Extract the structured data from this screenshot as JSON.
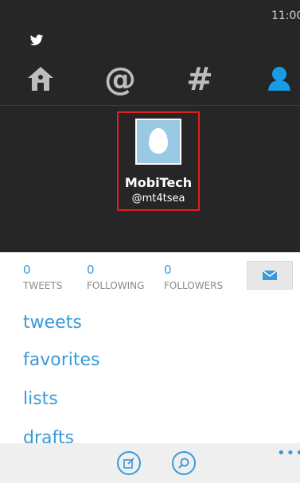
{
  "status_bar": {
    "time": "11:00"
  },
  "nav_tabs": [
    {
      "icon": "home-icon",
      "glyph": "⌂",
      "color": "#bdbdbd"
    },
    {
      "icon": "mentions-icon",
      "glyph": "@",
      "color": "#bdbdbd"
    },
    {
      "icon": "hashtag-icon",
      "glyph": "#",
      "color": "#bdbdbd"
    },
    {
      "icon": "profile-icon",
      "glyph": "",
      "color": "#1a9be6"
    }
  ],
  "profile": {
    "name": "MobiTech",
    "handle": "@mt4tsea"
  },
  "stats": [
    {
      "value": "0",
      "label": "TWEETS"
    },
    {
      "value": "0",
      "label": "FOLLOWING"
    },
    {
      "value": "0",
      "label": "FOLLOWERS"
    }
  ],
  "menu": {
    "tweets": "tweets",
    "favorites": "favorites",
    "lists": "lists",
    "drafts": "drafts"
  },
  "app_bar": {
    "more": "•••"
  },
  "colors": {
    "accent": "#3a9ad9",
    "header_bg": "#262626",
    "highlight_border": "#e02020",
    "avatar_bg": "#9ac9e6"
  }
}
